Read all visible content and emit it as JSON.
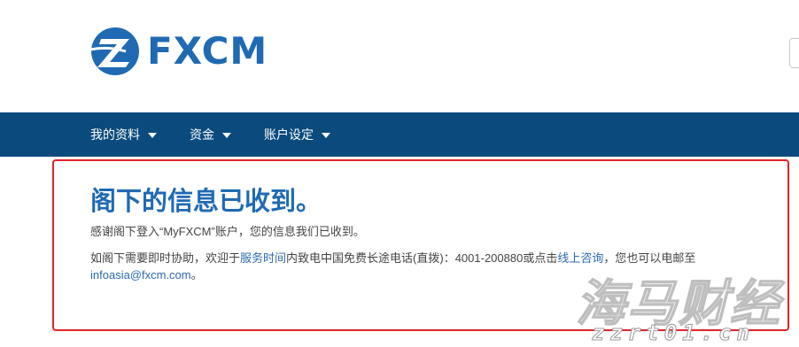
{
  "brand": {
    "name": "FXCM",
    "color": "#1f6ab3"
  },
  "nav": {
    "bg_color": "#0b4a7d",
    "items": [
      {
        "label": "我的资料",
        "icon": "chevron-down-icon"
      },
      {
        "label": "资金",
        "icon": "chevron-down-icon"
      },
      {
        "label": "账户设定",
        "icon": "chevron-down-icon"
      }
    ]
  },
  "confirmation": {
    "title": "阁下的信息已收到。",
    "message": "感谢阁下登入“MyFXCM”账户，您的信息我们已收到。",
    "help": {
      "part1": "如阁下需要即时协助，欢迎于",
      "link_hours": "服务时间",
      "part2": "内致电中国免费长途电话(直拨)：4001-200880或点击",
      "link_online": "线上咨询",
      "part3": "，您也可以电邮至",
      "email": "infoasia@fxcm.com",
      "part4": "。"
    },
    "border_color": "#e3232b"
  },
  "watermark": {
    "text": "海马财经",
    "url": "zzrt01.cn"
  }
}
